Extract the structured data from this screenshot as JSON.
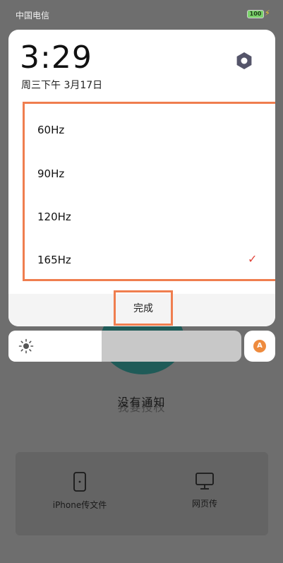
{
  "status_bar": {
    "carrier": "中国电信",
    "battery": "100"
  },
  "clock": {
    "time": "3:29",
    "date": "周三下午 3月17日"
  },
  "refresh_rates": {
    "options": [
      {
        "label": "60Hz",
        "selected": false
      },
      {
        "label": "90Hz",
        "selected": false
      },
      {
        "label": "120Hz",
        "selected": false
      },
      {
        "label": "165Hz",
        "selected": true
      }
    ],
    "check_mark": "✓"
  },
  "done_label": "完成",
  "brightness": {
    "level_percent": 40
  },
  "auto_brightness_label": "A",
  "background_app": {
    "no_notifications": "没有通知",
    "authorize": "我要授权",
    "iphone_transfer": "iPhone传文件",
    "web_transfer": "网页传"
  },
  "colors": {
    "highlight": "#ef7e4f",
    "check": "#e1453a",
    "battery": "#7bd36b",
    "auto": "#ee8b3e"
  },
  "icons": {
    "settings": "hexagon-settings-icon",
    "brightness": "sun-icon",
    "phone": "phone-icon",
    "monitor": "monitor-icon"
  }
}
